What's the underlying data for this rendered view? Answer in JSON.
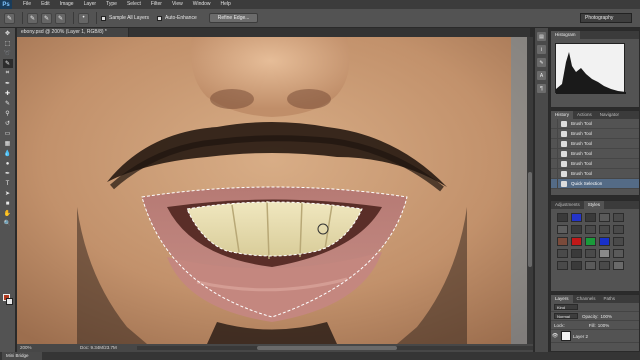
{
  "app": {
    "logo": "Ps",
    "menu": [
      "File",
      "Edit",
      "Image",
      "Layer",
      "Type",
      "Select",
      "Filter",
      "View",
      "Window",
      "Help"
    ]
  },
  "options_bar": {
    "checkbox_sample_all_layers": "Sample All Layers",
    "checkbox_auto_enhance": "Auto-Enhance",
    "refine_edge_button": "Refine Edge...",
    "workspace": "Photography"
  },
  "document": {
    "tab_title": "ebony.psd @ 200% (Layer 1, RGB/8) *",
    "zoom": "200%",
    "doc_size": "Doc: 9.34M/23.7M"
  },
  "panels": {
    "histogram": {
      "tabs": [
        "Histogram"
      ]
    },
    "history": {
      "tabs": [
        "History",
        "Actions",
        "Navigator"
      ],
      "items": [
        {
          "label": "Brush Tool",
          "selected": false
        },
        {
          "label": "Brush Tool",
          "selected": false
        },
        {
          "label": "Brush Tool",
          "selected": false
        },
        {
          "label": "Brush Tool",
          "selected": false
        },
        {
          "label": "Brush Tool",
          "selected": false
        },
        {
          "label": "Brush Tool",
          "selected": false
        },
        {
          "label": "Quick Selection",
          "selected": true
        }
      ]
    },
    "swatches": {
      "tabs": [
        "Adjustments",
        "Styles"
      ],
      "colors": [
        "#3a3a3a",
        "#2434c8",
        "#3a3a3a",
        "#5a5a5a",
        "#4a4a4a",
        "#5e5e5e",
        "#3a3a3a",
        "#4a4a4a",
        "#4a4a4a",
        "#4a4a4a",
        "#7a4a3a",
        "#c01818",
        "#1a9a3a",
        "#1830c8",
        "#4a4a4a",
        "#4a4a4a",
        "#3a3a3a",
        "#4a4a4a",
        "#8a8a8a",
        "#5a5a5a",
        "#4a4a4a",
        "#3a3a3a",
        "#5a5a5a",
        "#4a4a4a",
        "#6a6a6a"
      ]
    },
    "layers": {
      "tabs": [
        "Layers",
        "Channels",
        "Paths"
      ],
      "kind_label": "Kind",
      "blend_mode": "Normal",
      "opacity_label": "Opacity:",
      "opacity_value": "100%",
      "lock_label": "Lock:",
      "fill_label": "Fill:",
      "fill_value": "100%",
      "items": [
        {
          "name": "Layer 2",
          "thumb": "#f4f4f4",
          "selected": false
        },
        {
          "name": "Layer 1",
          "thumb": "#b08060",
          "selected": true
        }
      ]
    }
  },
  "bottom": {
    "mini_bridge": "Mini Bridge"
  }
}
